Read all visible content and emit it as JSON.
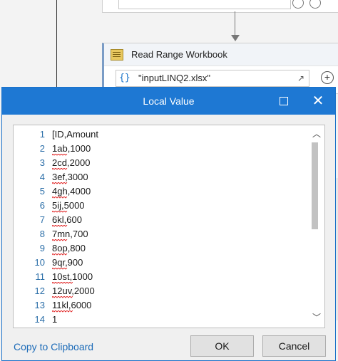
{
  "activity": {
    "title": "Read Range Workbook",
    "field_brace": "{}",
    "field_value": "\"inputLINQ2.xlsx\"",
    "expand_icon": "↗",
    "add_icon": "+"
  },
  "dialog": {
    "title": "Local Value",
    "maximize_icon": "maximize-icon",
    "close_icon": "✕",
    "lines": [
      {
        "num": "1",
        "text": "[ID,Amount"
      },
      {
        "num": "2",
        "text": "1ab,1000"
      },
      {
        "num": "3",
        "text": "2cd,2000"
      },
      {
        "num": "4",
        "text": "3ef,3000"
      },
      {
        "num": "5",
        "text": "4gh,4000"
      },
      {
        "num": "6",
        "text": "5ij,5000"
      },
      {
        "num": "7",
        "text": "6kl,600"
      },
      {
        "num": "8",
        "text": "7mn,700"
      },
      {
        "num": "9",
        "text": "8op,800"
      },
      {
        "num": "10",
        "text": "9qr,900"
      },
      {
        "num": "11",
        "text": "10st,1000"
      },
      {
        "num": "12",
        "text": "12uv,2000"
      },
      {
        "num": "13",
        "text": "11kl,6000"
      },
      {
        "num": "14",
        "text": "1"
      }
    ],
    "copy_label": "Copy to Clipboard",
    "ok_label": "OK",
    "cancel_label": "Cancel",
    "scroll_up": "︿",
    "scroll_down": "﹀"
  },
  "colors": {
    "titlebar": "#1e78d3",
    "link": "#1c6bb8",
    "line_numbers": "#2b6ea8",
    "spell_squiggle": "#e02020"
  }
}
